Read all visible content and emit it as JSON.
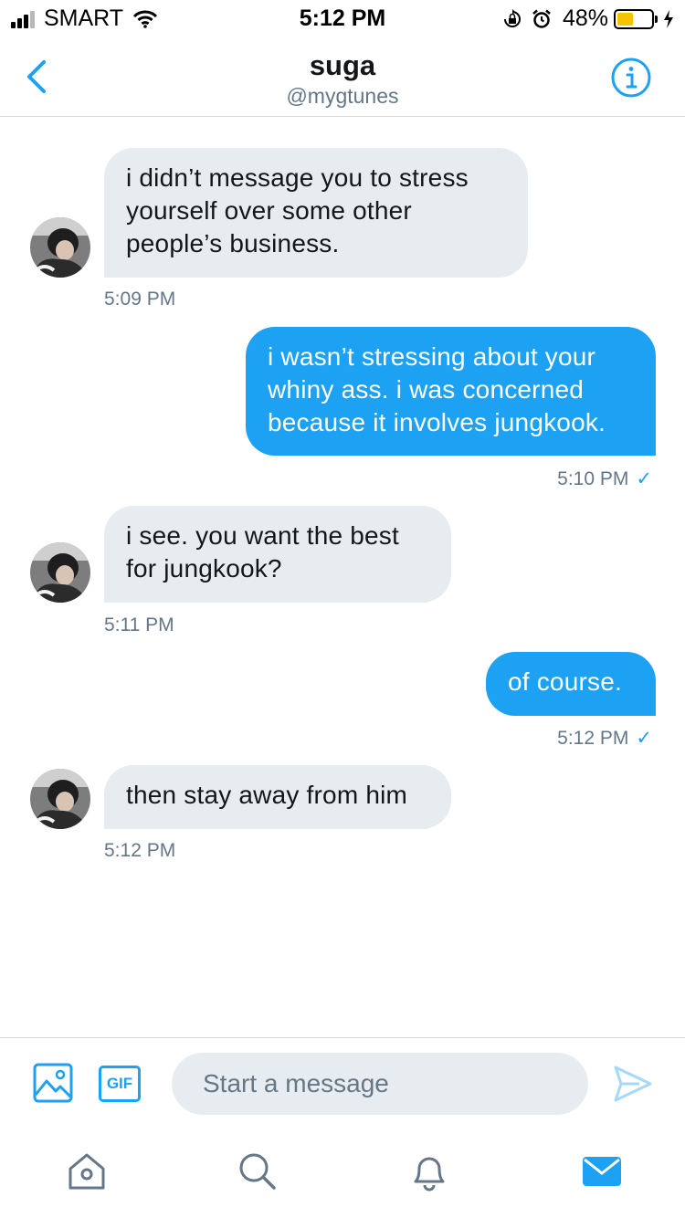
{
  "status_bar": {
    "carrier": "SMART",
    "time": "5:12 PM",
    "battery_percent": "48%",
    "battery_level": 0.48,
    "battery_color": "#f5c400"
  },
  "header": {
    "title": "suga",
    "handle": "@mygtunes",
    "back_icon": "chevron-left-icon",
    "info_icon": "info-icon"
  },
  "messages": [
    {
      "direction": "incoming",
      "text": "i didn’t message you to stress yourself over some other people’s business.",
      "time": "5:09 PM"
    },
    {
      "direction": "outgoing",
      "text": "i wasn’t stressing about your whiny ass. i was concerned because it involves jungkook.",
      "time": "5:10 PM",
      "status": "✓"
    },
    {
      "direction": "incoming",
      "text": "i see. you want the best for jungkook?",
      "time": "5:11 PM"
    },
    {
      "direction": "outgoing",
      "text": "of course.",
      "time": "5:12 PM",
      "status": "✓"
    },
    {
      "direction": "incoming",
      "text": "then stay away from him",
      "time": "5:12 PM"
    }
  ],
  "composer": {
    "gif_label": "GIF",
    "placeholder": "Start a message",
    "media_icon": "image-icon",
    "send_icon": "send-icon"
  },
  "tabbar": {
    "items": [
      "home-icon",
      "search-icon",
      "notifications-icon",
      "messages-icon"
    ],
    "active": "messages-icon"
  },
  "colors": {
    "accent": "#1da1f2",
    "incoming_bubble": "#e6ecf0",
    "secondary_text": "#657786"
  }
}
